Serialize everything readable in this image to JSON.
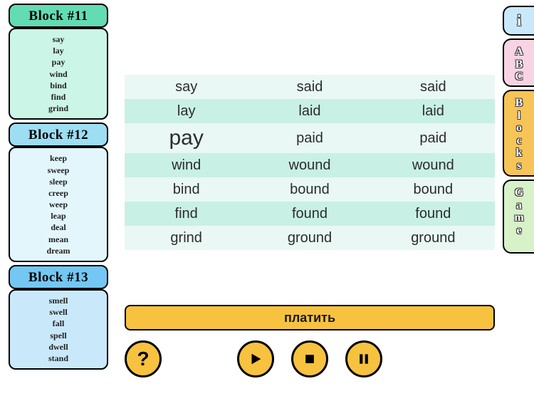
{
  "sidebar": {
    "blocks": [
      {
        "title": "Block #11",
        "words": [
          "say",
          "lay",
          "pay",
          "wind",
          "bind",
          "find",
          "grind"
        ]
      },
      {
        "title": "Block #12",
        "words": [
          "keep",
          "sweep",
          "sleep",
          "creep",
          "weep",
          "leap",
          "deal",
          "mean",
          "dream"
        ]
      },
      {
        "title": "Block #13",
        "words": [
          "smell",
          "swell",
          "fall",
          "spell",
          "dwell",
          "stand"
        ]
      }
    ]
  },
  "table": {
    "rows": [
      {
        "base": "say",
        "past": "said",
        "participle": "said",
        "emph": false
      },
      {
        "base": "lay",
        "past": "laid",
        "participle": "laid",
        "emph": false
      },
      {
        "base": "pay",
        "past": "paid",
        "participle": "paid",
        "emph": true
      },
      {
        "base": "wind",
        "past": "wound",
        "participle": "wound",
        "emph": false
      },
      {
        "base": "bind",
        "past": "bound",
        "participle": "bound",
        "emph": false
      },
      {
        "base": "find",
        "past": "found",
        "participle": "found",
        "emph": false
      },
      {
        "base": "grind",
        "past": "ground",
        "participle": "ground",
        "emph": false
      }
    ]
  },
  "translation": "платить",
  "controls": {
    "help": "?",
    "play": "play",
    "stop": "stop",
    "pause": "pause"
  },
  "tabs": {
    "info": "i",
    "abc": [
      "A",
      "B",
      "C"
    ],
    "blocks": [
      "B",
      "l",
      "o",
      "c",
      "k",
      "s"
    ],
    "game": [
      "G",
      "a",
      "m",
      "e"
    ]
  }
}
